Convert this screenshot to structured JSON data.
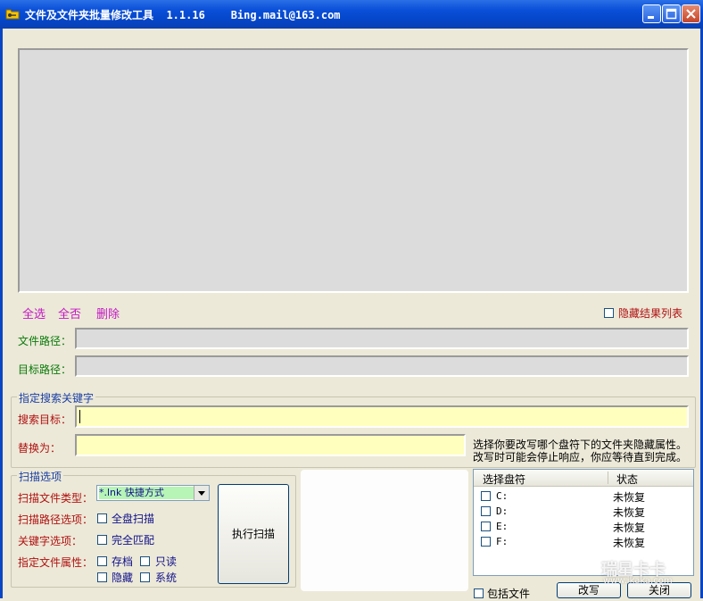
{
  "window": {
    "title": "文件及文件夹批量修改工具  1.1.16    Bing.mail@163.com",
    "buttons": [
      "minimize",
      "maximize",
      "close"
    ],
    "icon": "folder-key-icon"
  },
  "results": {
    "select_all": "全选",
    "select_none": "全否",
    "delete": "删除",
    "hide_list_label": "隐藏结果列表",
    "hide_list_checked": false
  },
  "paths": {
    "file_path_label": "文件路径：",
    "file_path_value": "",
    "target_path_label": "目标路径：",
    "target_path_value": ""
  },
  "keywords": {
    "group_title": "指定搜索关键字",
    "search_label": "搜索目标：",
    "search_value": "",
    "replace_label": "替换为：",
    "replace_value": ""
  },
  "hint": {
    "line1": "选择你要改写哪个盘符下的文件夹隐藏属性。",
    "line2": "改写时可能会停止响应，你应等待直到完成。"
  },
  "scan": {
    "group_title": "扫描选项",
    "file_type_label": "扫描文件类型：",
    "file_type_value": "*.lnk 快捷方式",
    "path_option_label": "扫描路径选项：",
    "full_disk_label": "全盘扫描",
    "keyword_option_label": "关键字选项：",
    "exact_match_label": "完全匹配",
    "attr_label": "指定文件属性：",
    "archive_label": "存档",
    "readonly_label": "只读",
    "hidden_label": "隐藏",
    "system_label": "系统",
    "execute_label": "执行扫描"
  },
  "drives": {
    "col_select": "选择盘符",
    "col_status": "状态",
    "rows": [
      {
        "letter": "C:",
        "status": "未恢复"
      },
      {
        "letter": "D:",
        "status": "未恢复"
      },
      {
        "letter": "E:",
        "status": "未恢复"
      },
      {
        "letter": "F:",
        "status": "未恢复"
      }
    ]
  },
  "footer": {
    "include_files_label": "包括文件",
    "rewrite_label": "改写",
    "close_label": "关闭"
  },
  "watermark": {
    "brand": "瑞星卡卡",
    "url": "www.ikaka.com"
  },
  "colors": {
    "titlebar": "#0a4fd8",
    "pink_link": "#c416c4",
    "label_green": "#0a7a0a",
    "label_red": "#b01010",
    "yellow_field": "#ffffbe",
    "combo_highlight": "#b6f5b6"
  }
}
